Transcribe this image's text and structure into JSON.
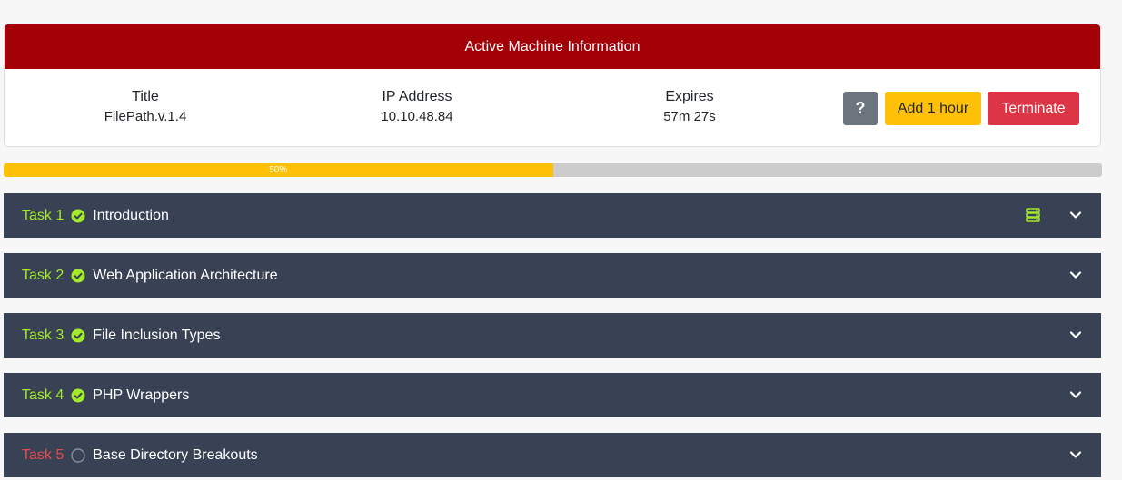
{
  "machine": {
    "header": "Active Machine Information",
    "title_label": "Title",
    "title_value": "FilePath.v.1.4",
    "ip_label": "IP Address",
    "ip_value": "10.10.48.84",
    "expires_label": "Expires",
    "expires_value": "57m 27s",
    "help_label": "?",
    "add_hour_label": "Add 1 hour",
    "terminate_label": "Terminate"
  },
  "progress": {
    "label": "50%",
    "value": 0.5
  },
  "colors": {
    "header_red": "#a30008",
    "task_bg": "#384254",
    "completed_green": "#a3ea2a",
    "incomplete_red": "#e54c4c",
    "progress_yellow": "#ffc107"
  },
  "tasks": [
    {
      "number": "Task 1",
      "title": "Introduction",
      "status": "complete",
      "has_machine_icon": true
    },
    {
      "number": "Task 2",
      "title": "Web Application Architecture",
      "status": "complete",
      "has_machine_icon": false
    },
    {
      "number": "Task 3",
      "title": "File Inclusion Types",
      "status": "complete",
      "has_machine_icon": false
    },
    {
      "number": "Task 4",
      "title": "PHP Wrappers",
      "status": "complete",
      "has_machine_icon": false
    },
    {
      "number": "Task 5",
      "title": "Base Directory Breakouts",
      "status": "incomplete",
      "has_machine_icon": false
    }
  ]
}
